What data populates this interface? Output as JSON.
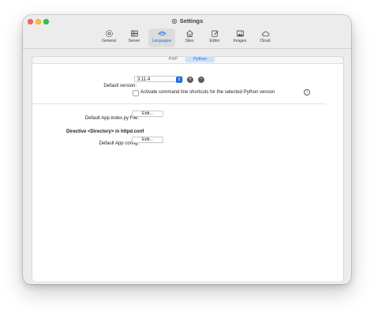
{
  "window": {
    "title": "Settings"
  },
  "toolbar": {
    "items": [
      {
        "label": "General",
        "icon": "gear-icon"
      },
      {
        "label": "Server",
        "icon": "server-icon"
      },
      {
        "label": "Languages",
        "icon": "languages-icon",
        "selected": true
      },
      {
        "label": "Sites",
        "icon": "house-icon"
      },
      {
        "label": "Editor",
        "icon": "editor-icon"
      },
      {
        "label": "Images",
        "icon": "image-icon"
      },
      {
        "label": "Cloud",
        "icon": "cloud-icon"
      }
    ]
  },
  "tabs": {
    "items": [
      "PHP",
      "Python"
    ],
    "selected": "Python"
  },
  "python": {
    "default_version_label": "Default version:",
    "default_version_value": "3.11.4",
    "shortcuts_label": "Activate command line shortcuts for the selected Python version",
    "shortcuts_checked": false,
    "default_app_label": "Default App index.py File:",
    "edit_label": "Edit...",
    "directive_heading": "Directive <Directory> in httpd.conf",
    "default_app_config_label": "Default App config:",
    "edit_config_label": "Edit..."
  },
  "colors": {
    "accent": "#1f6fe0",
    "close": "#ff5f57",
    "minimize": "#febc2e",
    "maximize": "#28c840"
  }
}
